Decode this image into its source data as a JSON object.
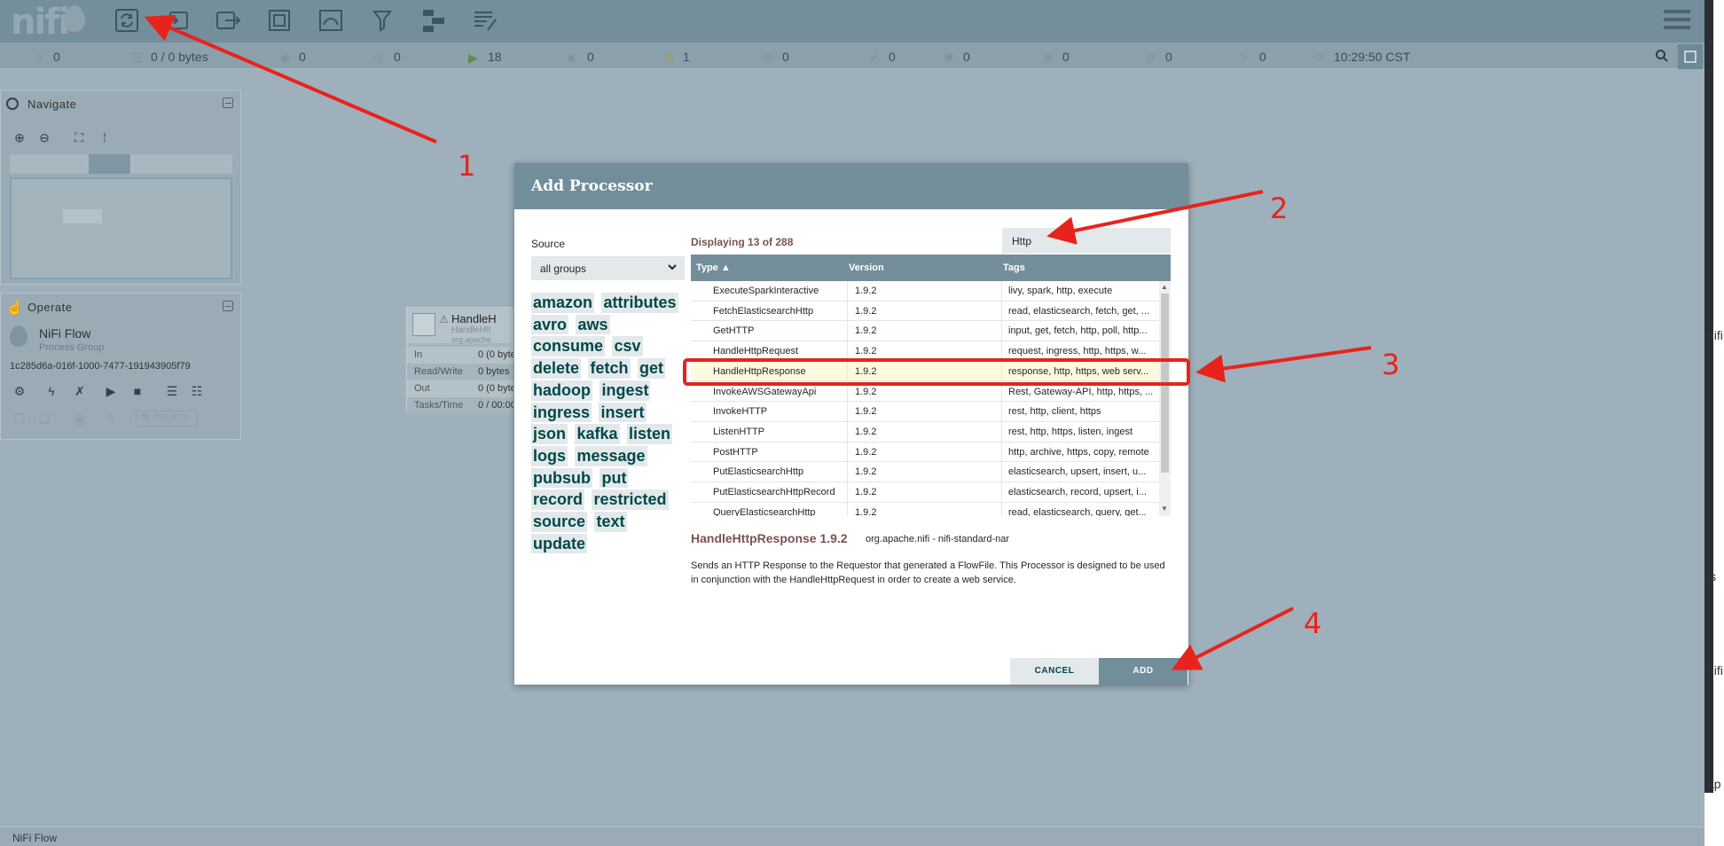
{
  "app": {
    "logo": "nifi"
  },
  "statusbar": {
    "items": [
      {
        "icon": "cluster-icon",
        "value": "0"
      },
      {
        "icon": "queue-icon",
        "value": "0 / 0 bytes"
      },
      {
        "icon": "transmitting-icon",
        "value": "0"
      },
      {
        "icon": "not-transmitting-icon",
        "value": "0"
      },
      {
        "icon": "running-icon",
        "value": "18"
      },
      {
        "icon": "stopped-icon",
        "value": "0"
      },
      {
        "icon": "invalid-icon",
        "value": "1"
      },
      {
        "icon": "disabled-icon",
        "value": "0"
      },
      {
        "icon": "up-to-date-icon",
        "value": "0"
      },
      {
        "icon": "locally-modified-icon",
        "value": "0"
      },
      {
        "icon": "stale-icon",
        "value": "0"
      },
      {
        "icon": "locally-modified-stale-icon",
        "value": "0"
      },
      {
        "icon": "sync-failure-icon",
        "value": "0"
      }
    ],
    "refresh_time": "10:29:50 CST"
  },
  "navigate": {
    "title": "Navigate"
  },
  "operate": {
    "title": "Operate",
    "component_name": "NiFi Flow",
    "component_type": "Process Group",
    "component_id": "1c285d6a-016f-1000-7477-191943905f79",
    "delete_label": "DELETE"
  },
  "canvas_processor": {
    "name": "HandleH",
    "type": "HandleHtt",
    "bundle": "org.apache.",
    "rows": [
      {
        "label": "In",
        "value": "0 (0 byte"
      },
      {
        "label": "Read/Write",
        "value": "0 bytes"
      },
      {
        "label": "Out",
        "value": "0 (0 byte"
      },
      {
        "label": "Tasks/Time",
        "value": "0 / 00:00"
      }
    ]
  },
  "footer": {
    "breadcrumb": "NiFi Flow"
  },
  "right_strip": {
    "texts": [
      "nifi",
      "is",
      "nifi",
      "ap"
    ]
  },
  "dialog": {
    "title": "Add Processor",
    "source_label": "Source",
    "source_value": "all groups",
    "displaying": "Displaying 13 of 288",
    "filter_value": "Http",
    "columns": {
      "type": "Type",
      "version": "Version",
      "tags": "Tags"
    },
    "tags": [
      "amazon",
      "attributes",
      "avro",
      "aws",
      "consume",
      "csv",
      "delete",
      "fetch",
      "get",
      "hadoop",
      "ingest",
      "ingress",
      "insert",
      "json",
      "kafka",
      "listen",
      "logs",
      "message",
      "pubsub",
      "put",
      "record",
      "restricted",
      "source",
      "text",
      "update"
    ],
    "rows": [
      {
        "type": "ExecuteSparkInteractive",
        "version": "1.9.2",
        "tags": "livy, spark, http, execute"
      },
      {
        "type": "FetchElasticsearchHttp",
        "version": "1.9.2",
        "tags": "read, elasticsearch, fetch, get, ..."
      },
      {
        "type": "GetHTTP",
        "version": "1.9.2",
        "tags": "input, get, fetch, http, poll, http..."
      },
      {
        "type": "HandleHttpRequest",
        "version": "1.9.2",
        "tags": "request, ingress, http, https, w..."
      },
      {
        "type": "HandleHttpResponse",
        "version": "1.9.2",
        "tags": "response, http, https, web serv..."
      },
      {
        "type": "InvokeAWSGatewayApi",
        "version": "1.9.2",
        "tags": "Rest, Gateway-API, http, https, ..."
      },
      {
        "type": "InvokeHTTP",
        "version": "1.9.2",
        "tags": "rest, http, client, https"
      },
      {
        "type": "ListenHTTP",
        "version": "1.9.2",
        "tags": "rest, http, https, listen, ingest"
      },
      {
        "type": "PostHTTP",
        "version": "1.9.2",
        "tags": "http, archive, https, copy, remote"
      },
      {
        "type": "PutElasticsearchHttp",
        "version": "1.9.2",
        "tags": "elasticsearch, upsert, insert, u..."
      },
      {
        "type": "PutElasticsearchHttpRecord",
        "version": "1.9.2",
        "tags": "elasticsearch, record, upsert, i..."
      },
      {
        "type": "QueryElasticsearchHttp",
        "version": "1.9.2",
        "tags": "read, elasticsearch, query, get..."
      }
    ],
    "selected_title": "HandleHttpResponse 1.9.2",
    "selected_bundle": "org.apache.nifi - nifi-standard-nar",
    "selected_description": "Sends an HTTP Response to the Requestor that generated a FlowFile. This Processor is designed to be used in conjunction with the HandleHttpRequest in order to create a web service.",
    "cancel_label": "CANCEL",
    "add_label": "ADD"
  },
  "annotations": {
    "labels": [
      "1",
      "2",
      "3",
      "4"
    ],
    "color": "#e8231c"
  }
}
